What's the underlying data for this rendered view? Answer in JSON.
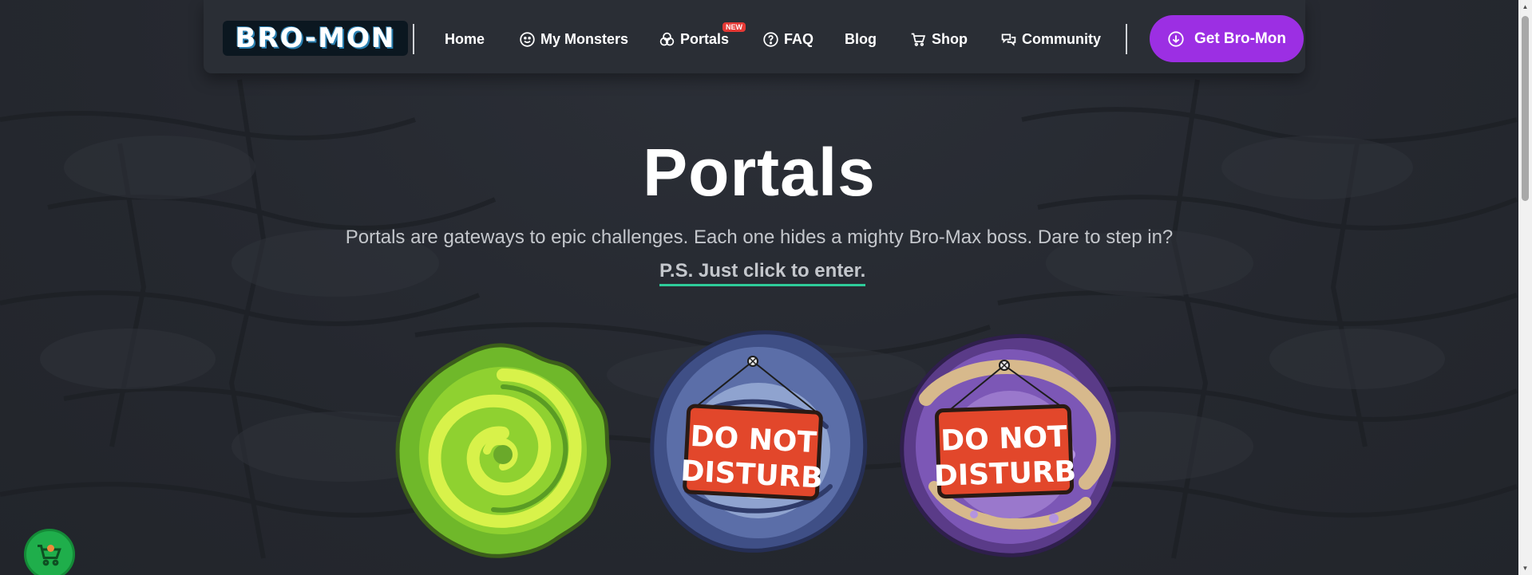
{
  "header": {
    "logo_text": "BRO-MON",
    "nav": [
      {
        "label": "Home",
        "icon": ""
      },
      {
        "label": "My Monsters",
        "icon": "smiley-icon"
      },
      {
        "label": "Portals",
        "icon": "portal-icon",
        "badge": "NEW"
      },
      {
        "label": "FAQ",
        "icon": "question-circle-icon"
      },
      {
        "label": "Blog",
        "icon": ""
      },
      {
        "label": "Shop",
        "icon": "cart-icon"
      },
      {
        "label": "Community",
        "icon": "chat-bubbles-icon"
      }
    ],
    "cta_label": "Get Bro-Mon",
    "cta_icon": "download-circle-icon"
  },
  "hero": {
    "title": "Portals",
    "subtitle": "Portals are gateways to epic challenges. Each one hides a mighty Bro-Max boss. Dare to step in?",
    "ps_link": "P.S. Just click to enter."
  },
  "portals": [
    {
      "name": "green-portal",
      "color": "#7cc62a",
      "locked": false
    },
    {
      "name": "blue-portal",
      "color": "#4b5d96",
      "locked": true,
      "sign_line1": "DO NOT",
      "sign_line2": "DISTURB"
    },
    {
      "name": "purple-portal",
      "color": "#6b4a9e",
      "locked": true,
      "sign_line1": "DO NOT",
      "sign_line2": "DISTURB"
    }
  ],
  "colors": {
    "background": "#262a31",
    "header": "#2a2e35",
    "cta": "#9c2fe3",
    "underline": "#2ecc9a",
    "sign": "#e2472b"
  }
}
